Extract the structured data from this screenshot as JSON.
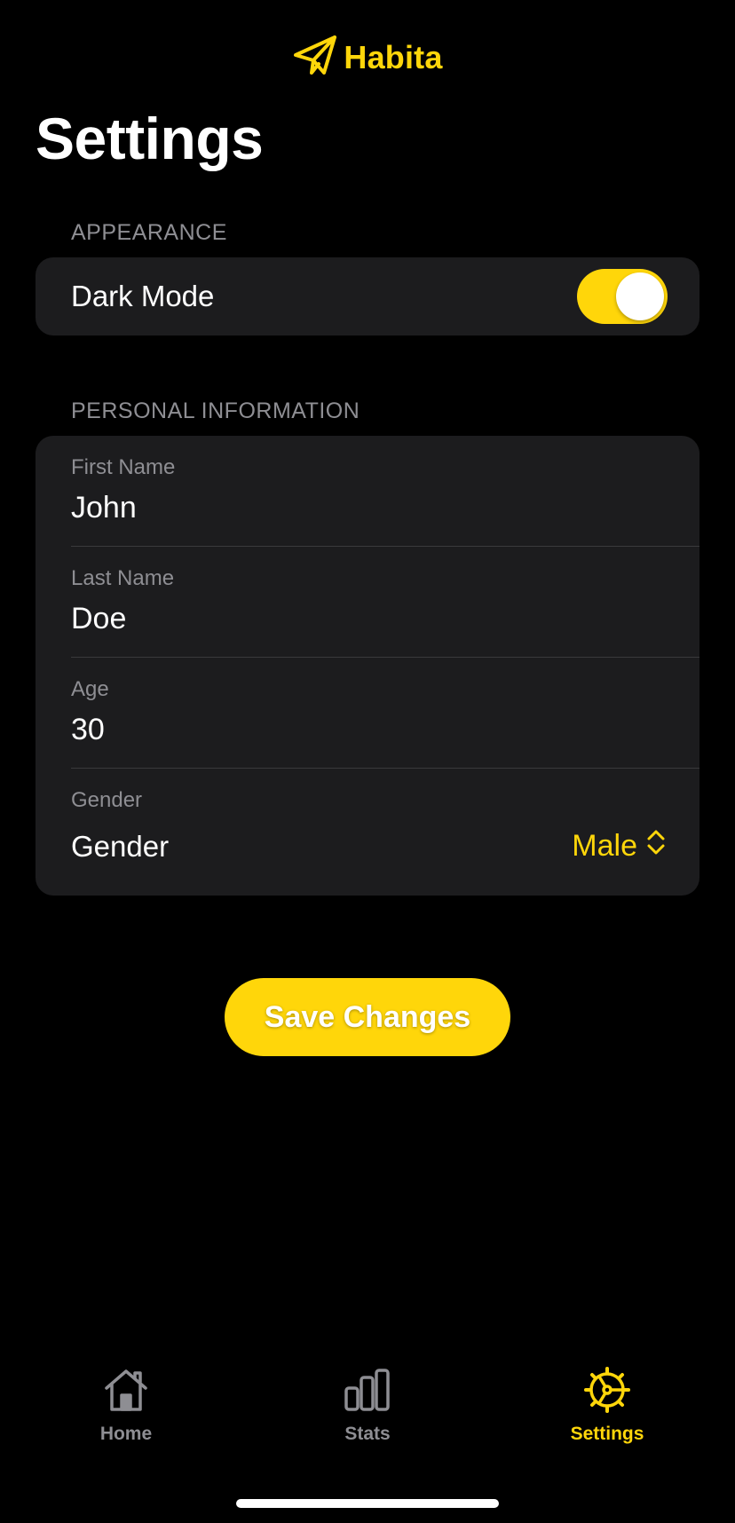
{
  "app": {
    "name": "Habita",
    "logo_icon": "paper-plane-icon",
    "accent_color": "#FFD60A"
  },
  "page": {
    "title": "Settings"
  },
  "appearance": {
    "header": "APPEARANCE",
    "dark_mode_label": "Dark Mode",
    "dark_mode_on": true
  },
  "personal": {
    "header": "PERSONAL INFORMATION",
    "first_name_label": "First Name",
    "first_name_value": "John",
    "last_name_label": "Last Name",
    "last_name_value": "Doe",
    "age_label": "Age",
    "age_value": "30",
    "gender_label": "Gender",
    "gender_picker_label": "Gender",
    "gender_value": "Male"
  },
  "actions": {
    "save_label": "Save Changes"
  },
  "tabbar": {
    "items": [
      {
        "label": "Home",
        "icon": "house-icon",
        "active": false
      },
      {
        "label": "Stats",
        "icon": "bar-chart-icon",
        "active": false
      },
      {
        "label": "Settings",
        "icon": "gear-icon",
        "active": true
      }
    ]
  }
}
